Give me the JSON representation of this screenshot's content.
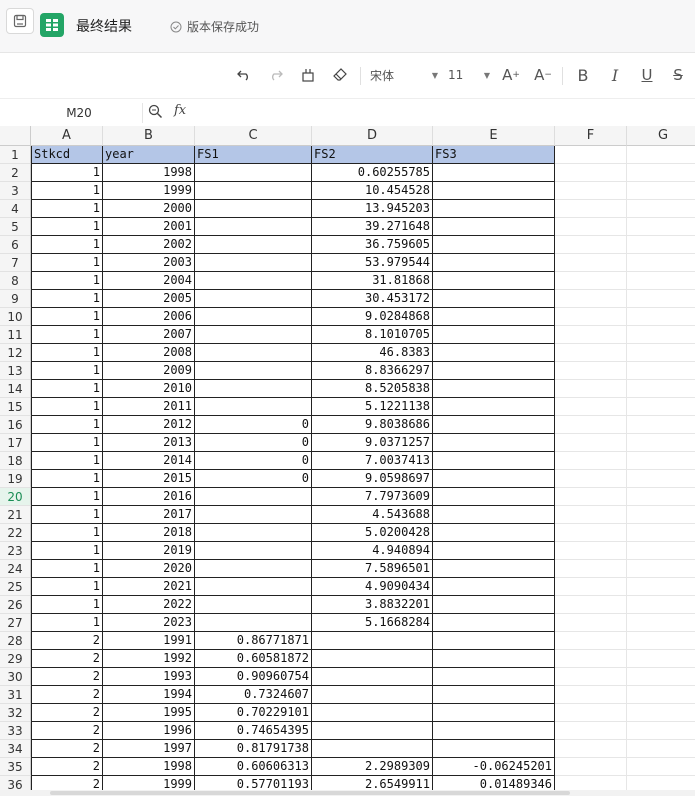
{
  "app": {
    "title": "最终结果",
    "save_status": "版本保存成功"
  },
  "toolbar": {
    "font_name": "宋体",
    "font_size": "11",
    "bold": "B",
    "italic": "I",
    "underline": "U",
    "strike": "S"
  },
  "formula_bar": {
    "cell_ref": "M20",
    "fx_label": "fx",
    "value": ""
  },
  "columns": [
    "A",
    "B",
    "C",
    "D",
    "E",
    "F",
    "G"
  ],
  "selected_row": "20",
  "sheet": {
    "header": [
      "Stkcd",
      "year",
      "FS1",
      "FS2",
      "FS3"
    ],
    "rows": [
      [
        "1",
        "1998",
        "",
        "0.60255785",
        ""
      ],
      [
        "1",
        "1999",
        "",
        "10.454528",
        ""
      ],
      [
        "1",
        "2000",
        "",
        "13.945203",
        ""
      ],
      [
        "1",
        "2001",
        "",
        "39.271648",
        ""
      ],
      [
        "1",
        "2002",
        "",
        "36.759605",
        ""
      ],
      [
        "1",
        "2003",
        "",
        "53.979544",
        ""
      ],
      [
        "1",
        "2004",
        "",
        "31.81868",
        ""
      ],
      [
        "1",
        "2005",
        "",
        "30.453172",
        ""
      ],
      [
        "1",
        "2006",
        "",
        "9.0284868",
        ""
      ],
      [
        "1",
        "2007",
        "",
        "8.1010705",
        ""
      ],
      [
        "1",
        "2008",
        "",
        "46.8383",
        ""
      ],
      [
        "1",
        "2009",
        "",
        "8.8366297",
        ""
      ],
      [
        "1",
        "2010",
        "",
        "8.5205838",
        ""
      ],
      [
        "1",
        "2011",
        "",
        "5.1221138",
        ""
      ],
      [
        "1",
        "2012",
        "0",
        "9.8038686",
        ""
      ],
      [
        "1",
        "2013",
        "0",
        "9.0371257",
        ""
      ],
      [
        "1",
        "2014",
        "0",
        "7.0037413",
        ""
      ],
      [
        "1",
        "2015",
        "0",
        "9.0598697",
        ""
      ],
      [
        "1",
        "2016",
        "",
        "7.7973609",
        ""
      ],
      [
        "1",
        "2017",
        "",
        "4.543688",
        ""
      ],
      [
        "1",
        "2018",
        "",
        "5.0200428",
        ""
      ],
      [
        "1",
        "2019",
        "",
        "4.940894",
        ""
      ],
      [
        "1",
        "2020",
        "",
        "7.5896501",
        ""
      ],
      [
        "1",
        "2021",
        "",
        "4.9090434",
        ""
      ],
      [
        "1",
        "2022",
        "",
        "3.8832201",
        ""
      ],
      [
        "1",
        "2023",
        "",
        "5.1668284",
        ""
      ],
      [
        "2",
        "1991",
        "0.86771871",
        "",
        ""
      ],
      [
        "2",
        "1992",
        "0.60581872",
        "",
        ""
      ],
      [
        "2",
        "1993",
        "0.90960754",
        "",
        ""
      ],
      [
        "2",
        "1994",
        "0.7324607",
        "",
        ""
      ],
      [
        "2",
        "1995",
        "0.70229101",
        "",
        ""
      ],
      [
        "2",
        "1996",
        "0.74654395",
        "",
        ""
      ],
      [
        "2",
        "1997",
        "0.81791738",
        "",
        ""
      ],
      [
        "2",
        "1998",
        "0.60606313",
        "2.2989309",
        "-0.06245201"
      ],
      [
        "2",
        "1999",
        "0.57701193",
        "2.6549911",
        "0.01489346"
      ]
    ]
  },
  "colors": {
    "header_fill": "#b4c6e7",
    "accent_green": "#21a366"
  }
}
